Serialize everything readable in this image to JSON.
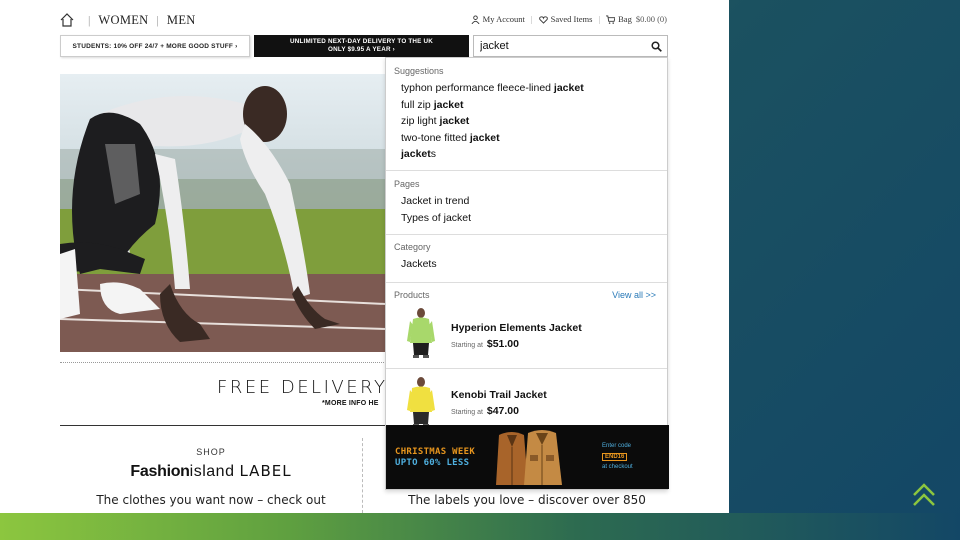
{
  "nav": {
    "women": "WOMEN",
    "men": "MEN",
    "my_account": "My Account",
    "saved_items": "Saved Items",
    "bag": "Bag",
    "bag_total": "$0.00 (0)"
  },
  "promos": {
    "students": "STUDENTS: 10% OFF 24/7 + MORE GOOD STUFF ›",
    "delivery_line1": "UNLIMITED NEXT-DAY DELIVERY TO THE UK",
    "delivery_line2": "ONLY $9.95 A YEAR ›"
  },
  "search": {
    "value": "jacket"
  },
  "dropdown": {
    "suggestions_heading": "Suggestions",
    "suggestions": [
      {
        "prefix": "typhon performance fleece-lined ",
        "bold": "jacket",
        "suffix": ""
      },
      {
        "prefix": "full zip ",
        "bold": "jacket",
        "suffix": ""
      },
      {
        "prefix": "zip light ",
        "bold": "jacket",
        "suffix": ""
      },
      {
        "prefix": "two-tone fitted ",
        "bold": "jacket",
        "suffix": ""
      },
      {
        "prefix": "",
        "bold": "jacket",
        "suffix": "s"
      }
    ],
    "pages_heading": "Pages",
    "pages": [
      "Jacket in trend",
      "Types of jacket"
    ],
    "category_heading": "Category",
    "categories": [
      "Jackets"
    ],
    "products_heading": "Products",
    "view_all": "View all >>",
    "products": [
      {
        "name": "Hyperion Elements Jacket",
        "starting": "Starting at",
        "price": "$51.00",
        "color": "#a8d86b"
      },
      {
        "name": "Kenobi Trail Jacket",
        "starting": "Starting at",
        "price": "$47.00",
        "color": "#f0e040"
      }
    ],
    "banner": {
      "title": "CHRISTMAS WEEK",
      "subtitle": "UPTO 60% LESS",
      "code_label": "Enter code",
      "code": "END16",
      "checkout": "at checkout"
    }
  },
  "page": {
    "free_delivery": "FREE DELIVERY* W",
    "more_info": "*MORE INFO HE",
    "shop_label": "SHOP",
    "brand_bold": "Fashion",
    "brand_light": "island",
    "brand_label": "LABEL",
    "left_text": "The clothes you want now – check out",
    "right_text": "The labels you love – discover over 850"
  },
  "colors": {
    "accent_blue": "#2a7ab8",
    "banner_orange": "#e8961e",
    "banner_blue": "#4fb0e0",
    "brand_green": "#8cc63f"
  }
}
